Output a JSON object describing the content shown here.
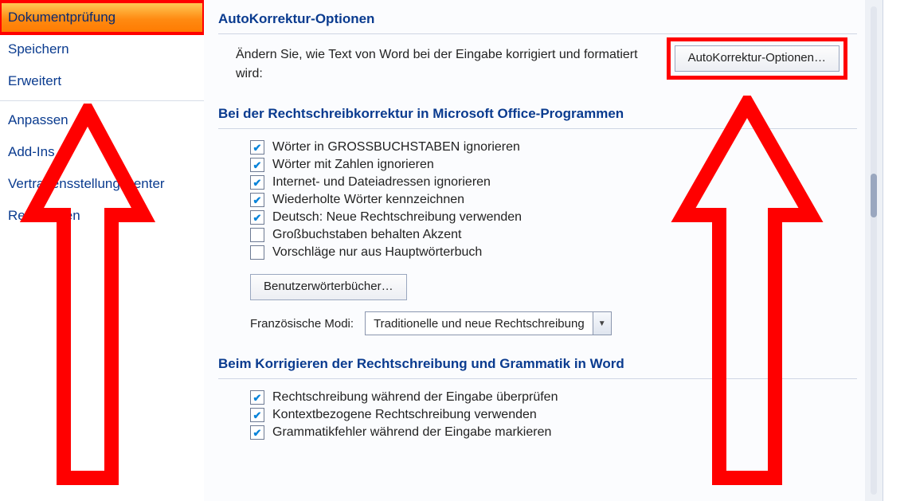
{
  "sidebar": {
    "items": [
      {
        "label": "Dokumentprüfung",
        "active": true
      },
      {
        "label": "Speichern"
      },
      {
        "label": "Erweitert"
      },
      {
        "sep": true
      },
      {
        "label": "Anpassen"
      },
      {
        "label": "Add-Ins"
      },
      {
        "label": "Vertrauensstellungscenter"
      },
      {
        "label": "Ressourcen"
      }
    ]
  },
  "section_autokorr": {
    "title": "AutoKorrektur-Optionen",
    "desc": "Ändern Sie, wie Text von Word bei der Eingabe korrigiert und formatiert wird:",
    "button": "AutoKorrektur-Optionen…"
  },
  "section_spell": {
    "title": "Bei der Rechtschreibkorrektur in Microsoft Office-Programmen",
    "opts": [
      {
        "checked": true,
        "label": "Wörter in GROSSBUCHSTABEN ignorieren"
      },
      {
        "checked": true,
        "label": "Wörter mit Zahlen ignorieren"
      },
      {
        "checked": true,
        "label": "Internet- und Dateiadressen ignorieren"
      },
      {
        "checked": true,
        "label": "Wiederholte Wörter kennzeichnen"
      },
      {
        "checked": true,
        "label": "Deutsch: Neue Rechtschreibung verwenden"
      },
      {
        "checked": false,
        "label": "Großbuchstaben behalten Akzent"
      },
      {
        "checked": false,
        "label": "Vorschläge nur aus Hauptwörterbuch"
      }
    ],
    "dict_button": "Benutzerwörterbücher…",
    "french_label": "Französische Modi:",
    "french_value": "Traditionelle und neue Rechtschreibung"
  },
  "section_word": {
    "title": "Beim Korrigieren der Rechtschreibung und Grammatik in Word",
    "opts": [
      {
        "checked": true,
        "label": "Rechtschreibung während der Eingabe überprüfen"
      },
      {
        "checked": true,
        "label": "Kontextbezogene Rechtschreibung verwenden"
      },
      {
        "checked": true,
        "label": "Grammatikfehler während der Eingabe markieren"
      }
    ]
  }
}
